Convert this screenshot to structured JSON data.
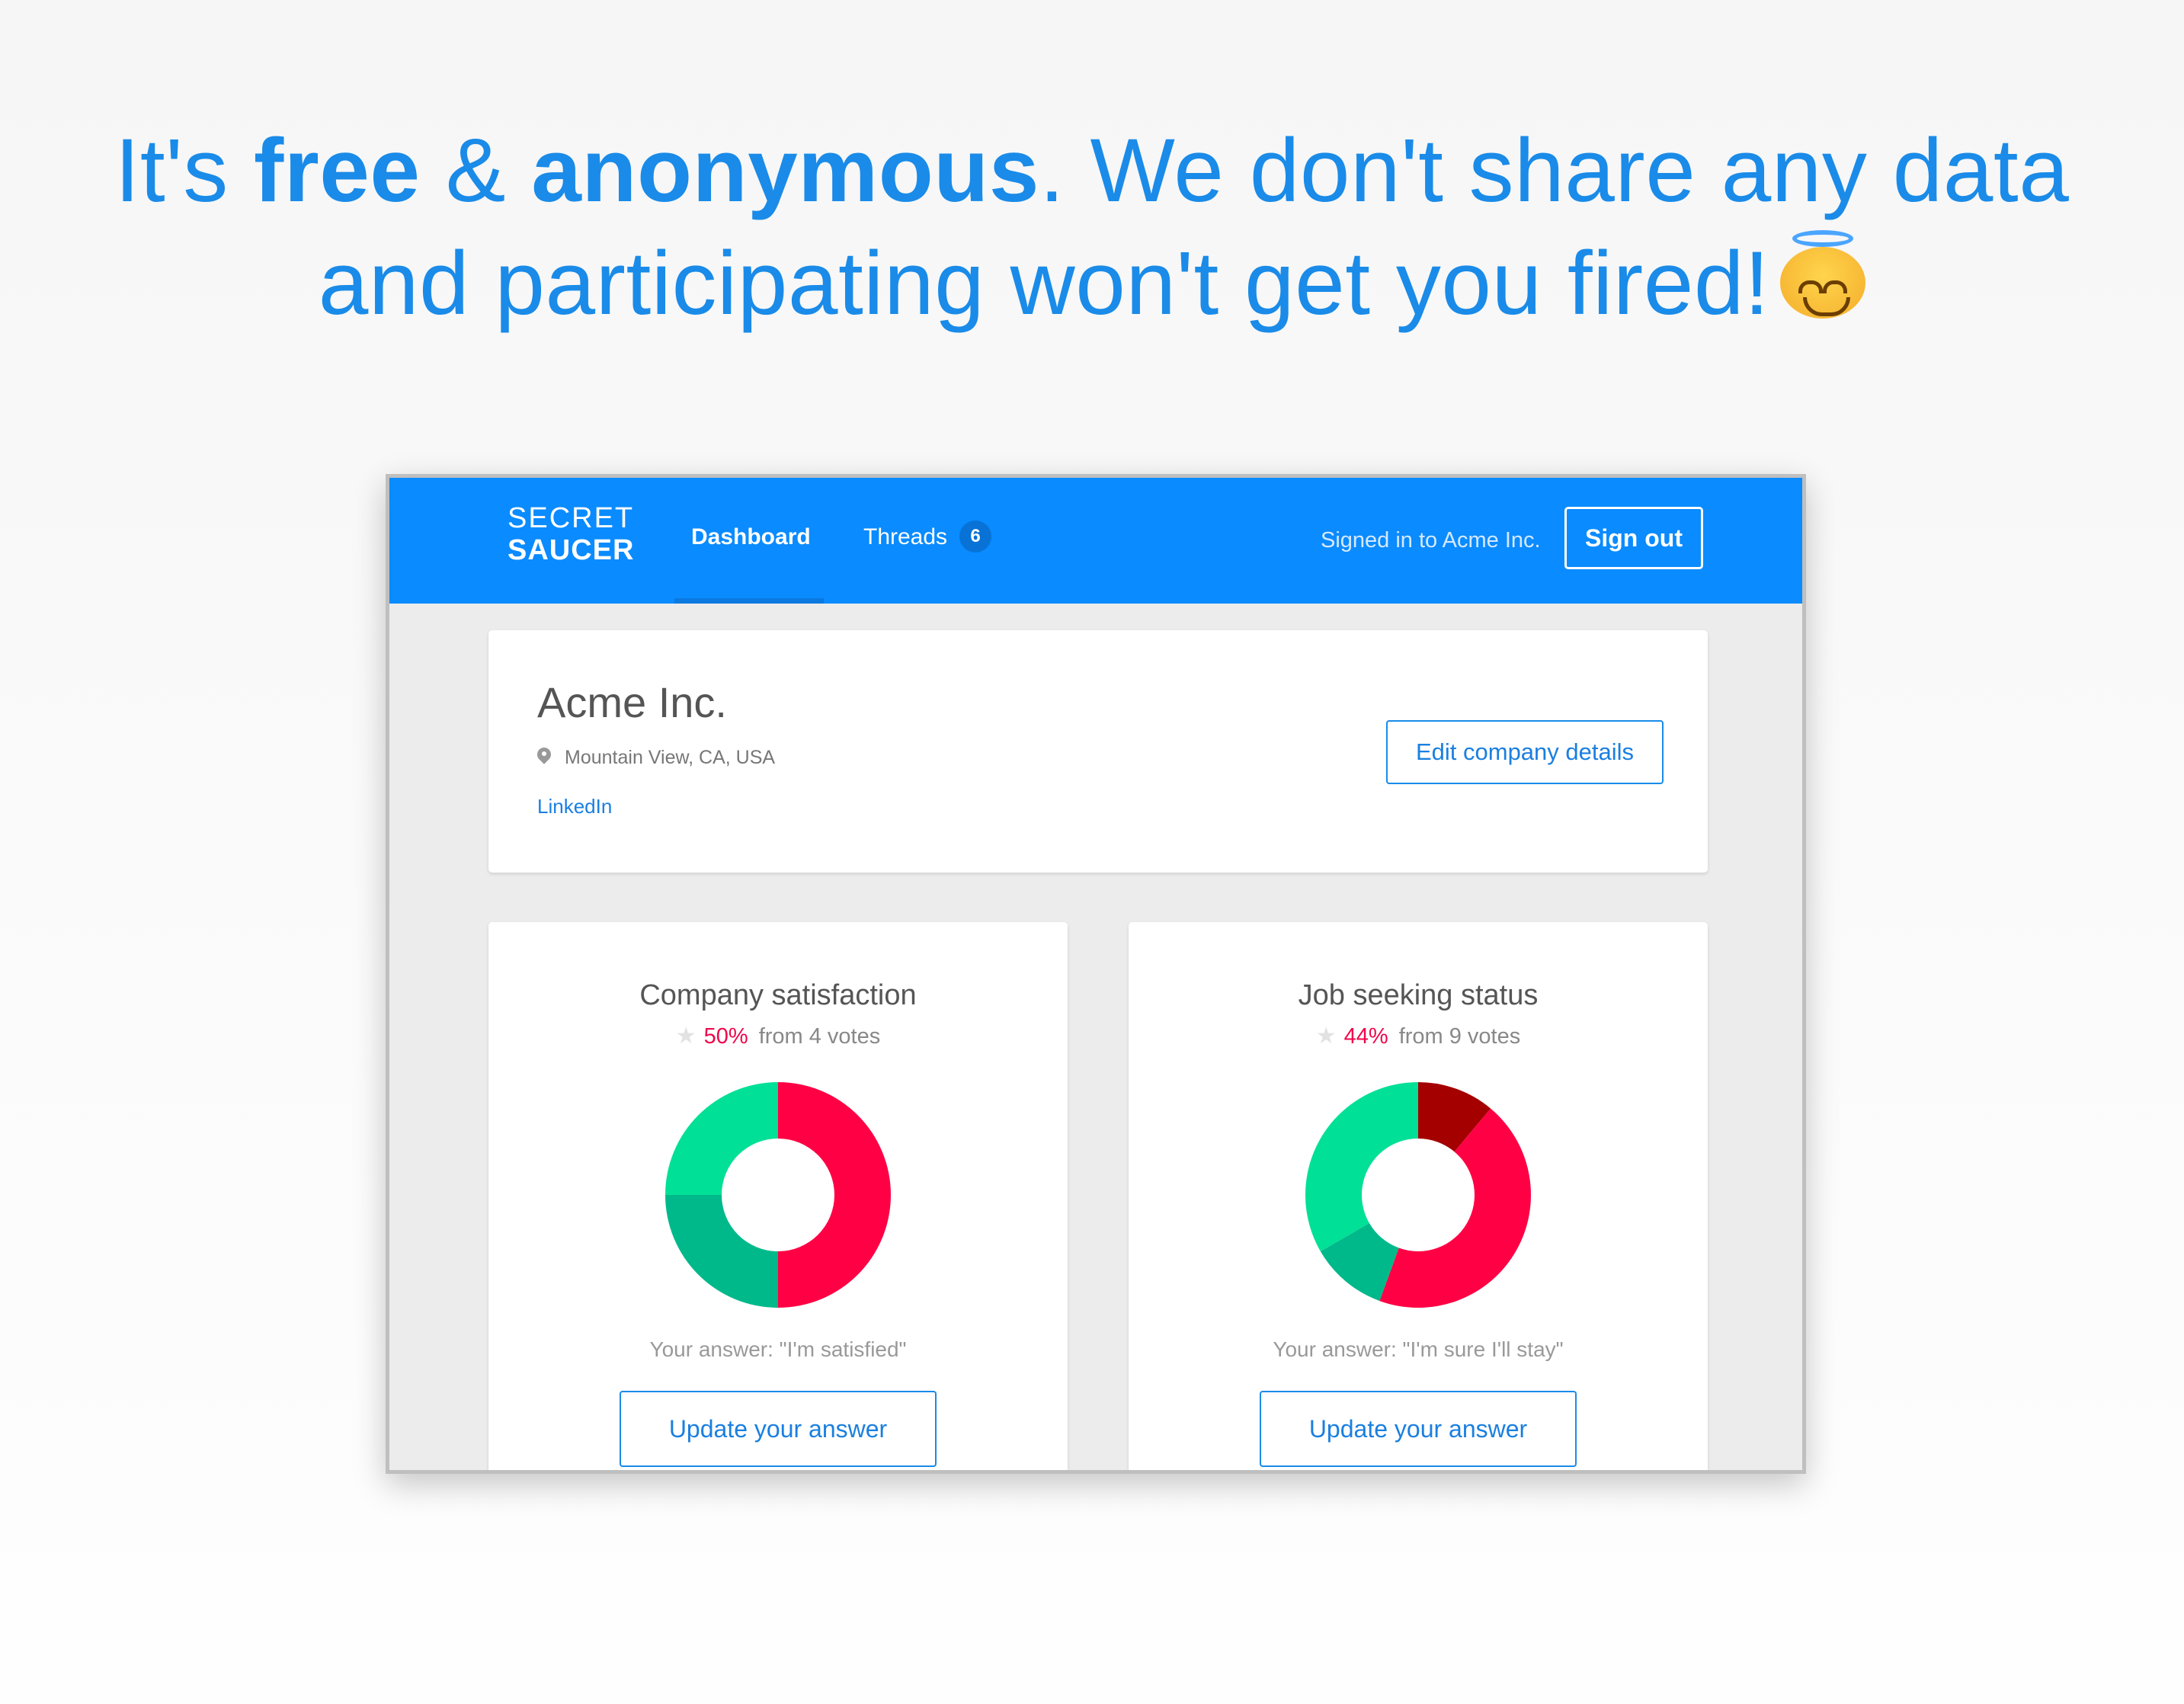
{
  "headline": {
    "part1": "It's ",
    "free": "free",
    "amp": " & ",
    "anonymous": "anonymous",
    "part2": ". We don't share any data",
    "line2": "and participating won't get you fired!",
    "emoji": "smiling-face-with-halo"
  },
  "navbar": {
    "logo_line1": "SECRET",
    "logo_line2": "SAUCER",
    "tab_dashboard": "Dashboard",
    "tab_threads": "Threads",
    "threads_badge": "6",
    "signed_in": "Signed in to Acme Inc.",
    "sign_out": "Sign out",
    "color": "#0a8bff"
  },
  "company": {
    "name": "Acme Inc.",
    "location": "Mountain View, CA, USA",
    "linkedin": "LinkedIn",
    "edit_button": "Edit company details"
  },
  "stats": [
    {
      "title": "Company satisfaction",
      "percent": "50%",
      "votes": "from 4 votes",
      "answer": "Your answer: \"I'm satisfied\"",
      "button": "Update your answer"
    },
    {
      "title": "Job seeking status",
      "percent": "44%",
      "votes": "from 9 votes",
      "answer": "Your answer: \"I'm sure I'll stay\"",
      "button": "Update your answer"
    }
  ],
  "chart_data": [
    {
      "type": "pie",
      "donut": true,
      "values": [
        2,
        1,
        1
      ],
      "colors": [
        "#ff0044",
        "#00b98a",
        "#00e096"
      ]
    },
    {
      "type": "pie",
      "donut": true,
      "values": [
        1,
        4,
        1,
        3
      ],
      "colors": [
        "#a50000",
        "#ff0044",
        "#00b98a",
        "#00e096"
      ]
    }
  ],
  "colors": {
    "accent": "#1a8be8",
    "highlight": "#f0064a"
  }
}
